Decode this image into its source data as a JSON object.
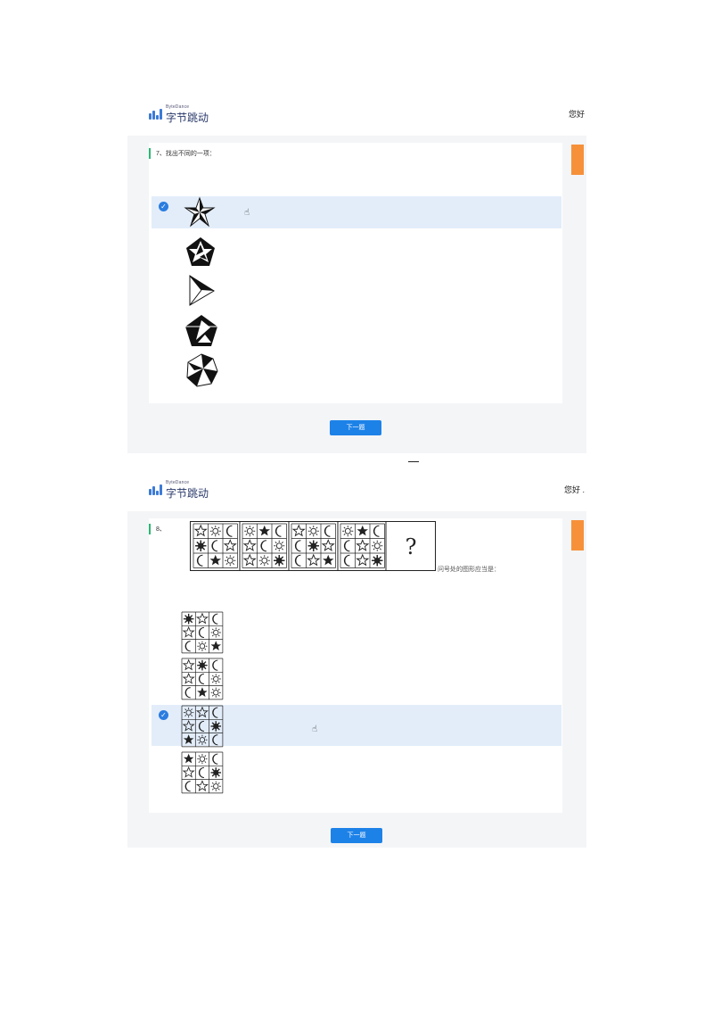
{
  "brand": {
    "name": "字节跳动",
    "sub": "ByteDance",
    "accent": "#3c7bd6"
  },
  "header": {
    "greeting": "您好"
  },
  "header2": {
    "greeting": "您好 ."
  },
  "q7": {
    "title": "7、找出不同的一项：",
    "options": [
      {
        "icon": "pinwheel-star-icon",
        "selected": true
      },
      {
        "icon": "star-in-pentagon-icon",
        "selected": false
      },
      {
        "icon": "triangle-fan-icon",
        "selected": false
      },
      {
        "icon": "shaded-pentagon-icon",
        "selected": false
      },
      {
        "icon": "faceted-heptagon-icon",
        "selected": false
      }
    ],
    "next_label": "下一题"
  },
  "q8": {
    "number": "8、",
    "prompt": "问号处的图形应当是：",
    "question_mark": "?",
    "options": [
      {
        "selected": false
      },
      {
        "selected": false
      },
      {
        "selected": true
      },
      {
        "selected": false
      }
    ],
    "next_label": "下一题"
  },
  "colors": {
    "selected_row": "#e3edfa",
    "check": "#2b7de0",
    "button": "#1d82e8",
    "scrollbar": "#f6913a",
    "question_bar": "#2bb673"
  }
}
